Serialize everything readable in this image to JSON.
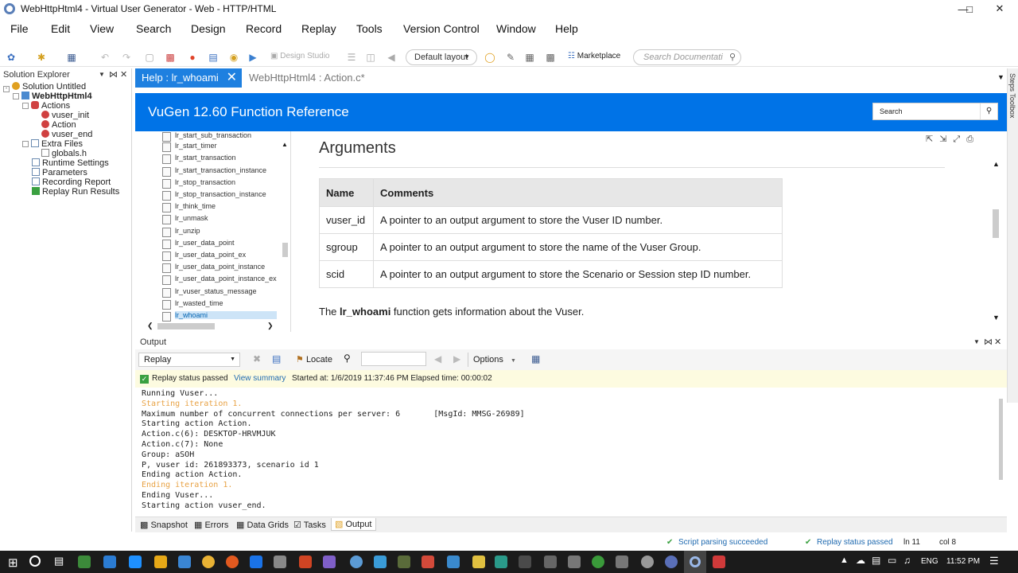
{
  "window": {
    "title": "WebHttpHtml4 - Virtual User Generator - Web - HTTP/HTML"
  },
  "menu": [
    "File",
    "Edit",
    "View",
    "Search",
    "Design",
    "Record",
    "Replay",
    "Tools",
    "Version Control",
    "Window",
    "Help"
  ],
  "toolbar": {
    "design_studio": "Design Studio",
    "layout": "Default layout",
    "marketplace": "Marketplace",
    "search_placeholder": "Search Documentati"
  },
  "solution_explorer": {
    "title": "Solution Explorer",
    "items": [
      "Solution Untitled",
      "WebHttpHtml4",
      "Actions",
      "vuser_init",
      "Action",
      "vuser_end",
      "Extra Files",
      "globals.h",
      "Runtime Settings",
      "Parameters",
      "Recording Report",
      "Replay Run Results"
    ]
  },
  "tabs": {
    "active": "Help : lr_whoami",
    "other": "WebHttpHtml4 : Action.c*"
  },
  "side_panel": "Steps Toolbox",
  "help": {
    "header": "VuGen 12.60 Function Reference",
    "search_label": "Search",
    "functions": [
      "lr_start_sub_transaction",
      "lr_start_timer",
      "lr_start_transaction",
      "lr_start_transaction_instance",
      "lr_stop_transaction",
      "lr_stop_transaction_instance",
      "lr_think_time",
      "lr_unmask",
      "lr_unzip",
      "lr_user_data_point",
      "lr_user_data_point_ex",
      "lr_user_data_point_instance",
      "lr_user_data_point_instance_ex",
      "lr_vuser_status_message",
      "lr_wasted_time",
      "lr_whoami"
    ],
    "section_title": "Arguments",
    "table_headers": [
      "Name",
      "Comments"
    ],
    "rows": [
      [
        "vuser_id",
        "A pointer to an output argument to store the Vuser ID number."
      ],
      [
        "sgroup",
        "A pointer to an output argument to store the name of the Vuser Group."
      ],
      [
        "scid",
        "A pointer to an output argument to store the Scenario or Session step ID number."
      ]
    ],
    "desc_pre": "The ",
    "desc_bold": "lr_whoami",
    "desc_post": " function gets information about the Vuser."
  },
  "output": {
    "title": "Output",
    "filter": "Replay",
    "locate": "Locate",
    "options": "Options",
    "status": "Replay status passed",
    "view_summary": "View summary",
    "started": "Started at: 1/6/2019 11:37:46 PM Elapsed time: 00:00:02",
    "log": [
      {
        "t": "Running Vuser...",
        "c": ""
      },
      {
        "t": "Starting iteration 1.",
        "c": "o"
      },
      {
        "t": "Maximum number of concurrent connections per server: 6       [MsgId: MMSG-26989]",
        "c": ""
      },
      {
        "t": "Starting action Action.",
        "c": ""
      },
      {
        "t": "Action.c(6): DESKTOP-HRVMJUK",
        "c": ""
      },
      {
        "t": "Action.c(7): None",
        "c": ""
      },
      {
        "t": "Group: aSOH",
        "c": ""
      },
      {
        "t": "P, vuser id: 261893373, scenario id 1",
        "c": ""
      },
      {
        "t": "Ending action Action.",
        "c": ""
      },
      {
        "t": "Ending iteration 1.",
        "c": "o"
      },
      {
        "t": "Ending Vuser...",
        "c": ""
      },
      {
        "t": "Starting action vuser_end.",
        "c": ""
      }
    ],
    "bottom_tabs": [
      "Snapshot",
      "Errors",
      "Data Grids",
      "Tasks",
      "Output"
    ]
  },
  "statusbar": {
    "parse": "Script parsing succeeded",
    "replay": "Replay status passed",
    "line": "ln 11",
    "col": "col 8"
  },
  "taskbar": {
    "lang": "ENG",
    "time": "11:52 PM"
  }
}
